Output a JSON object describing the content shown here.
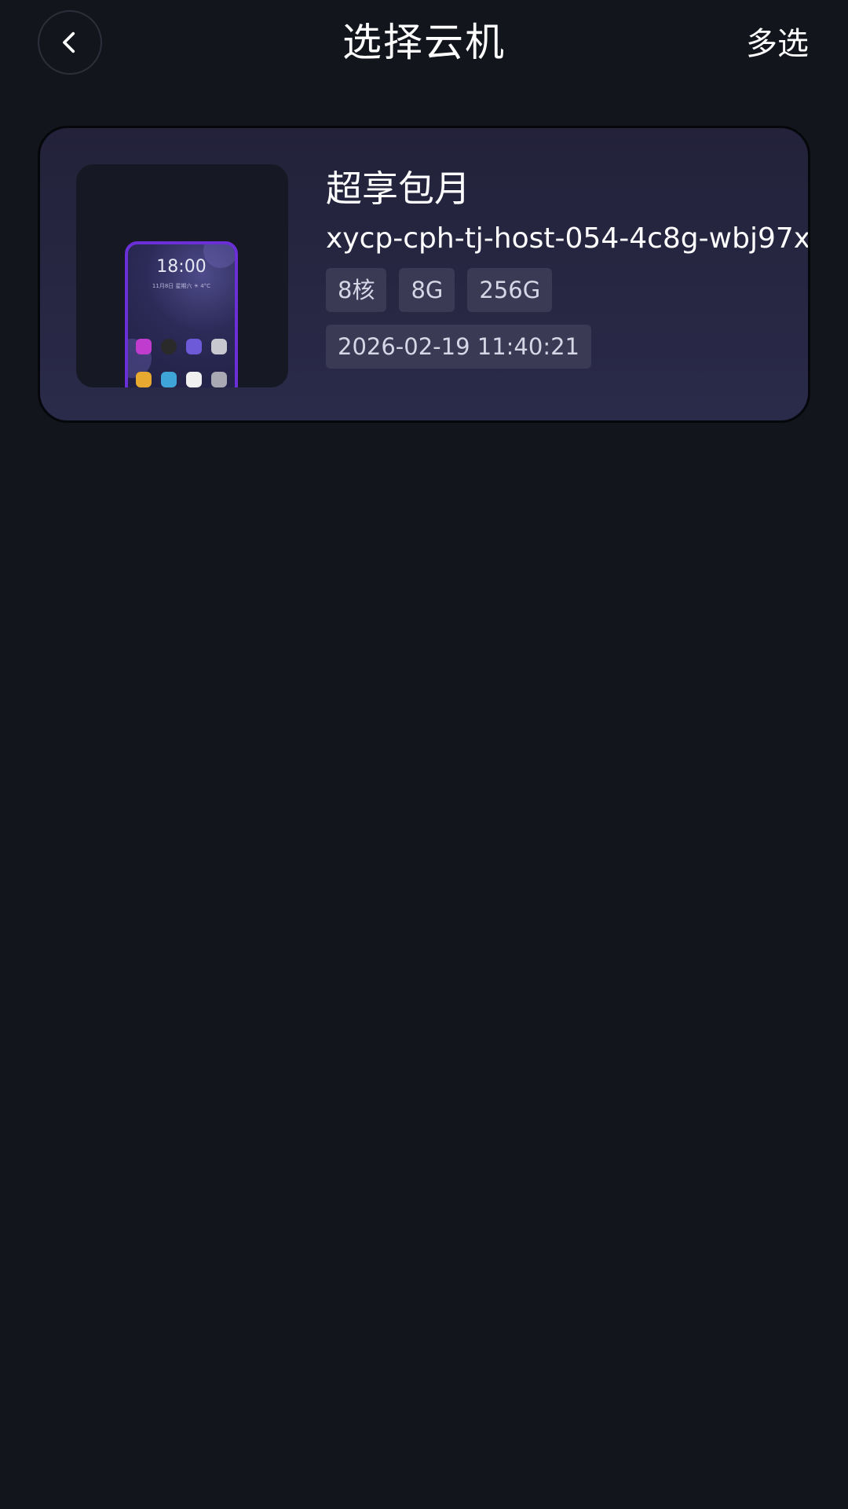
{
  "header": {
    "title": "选择云机",
    "back_icon": "chevron-left-icon",
    "multi_select_label": "多选"
  },
  "card": {
    "plan_name": "超享包月",
    "host_id": "xycp-cph-tj-host-054-4c8g-wbj97x",
    "tags": [
      "8核",
      "8G",
      "256G"
    ],
    "datetime": "2026-02-19 11:40:21",
    "thumbnail": {
      "time": "18:00",
      "subtitle": "11月8日 星期六  ☀ 4°C"
    }
  },
  "colors": {
    "background": "#13151d",
    "card_gradient_top": "#23223a",
    "card_gradient_bottom": "#2a2a4a",
    "tag_background": "#3a3a55",
    "phone_frame": "#6b2fd8"
  }
}
